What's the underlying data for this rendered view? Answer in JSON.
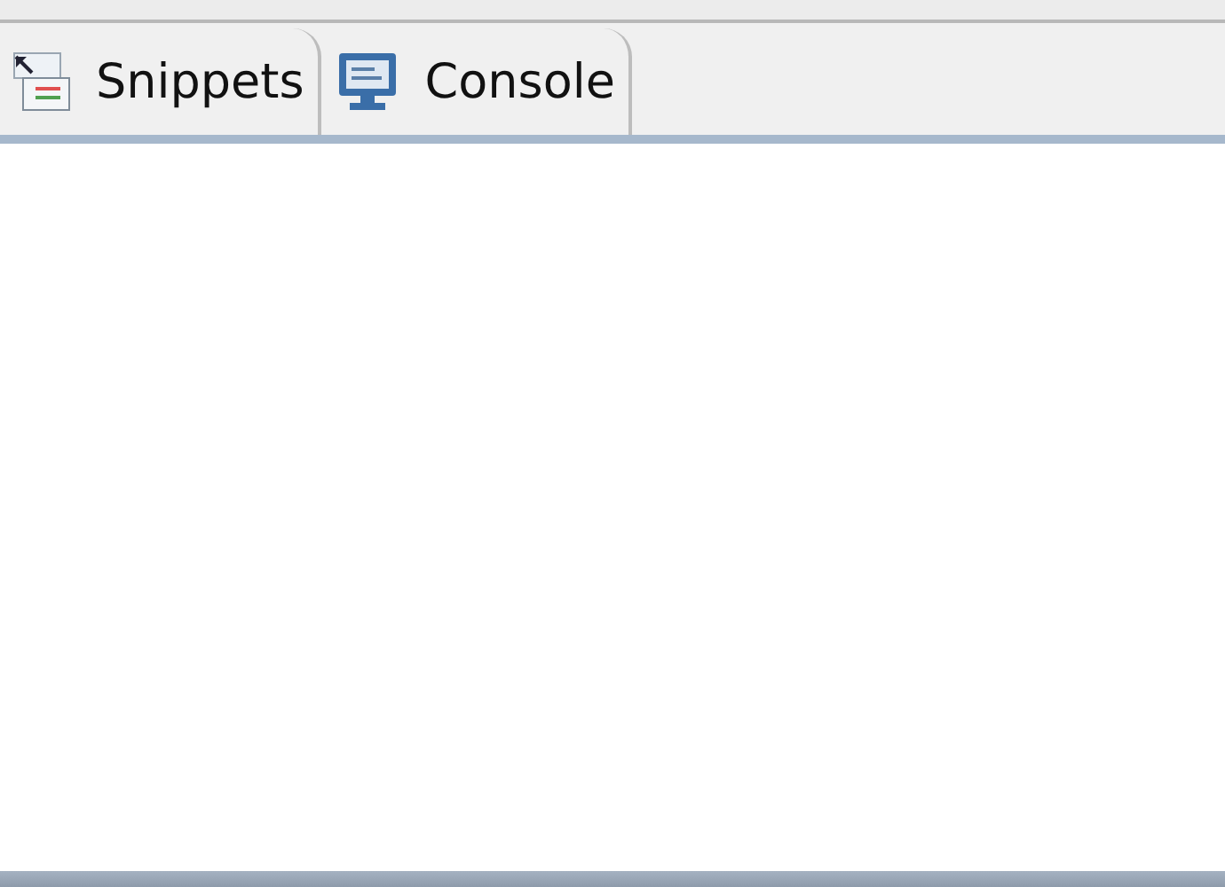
{
  "tabs": [
    {
      "label": "Snippets",
      "kind": "snippets",
      "selected": false
    },
    {
      "label": "Console",
      "kind": "console",
      "selected": false
    }
  ]
}
